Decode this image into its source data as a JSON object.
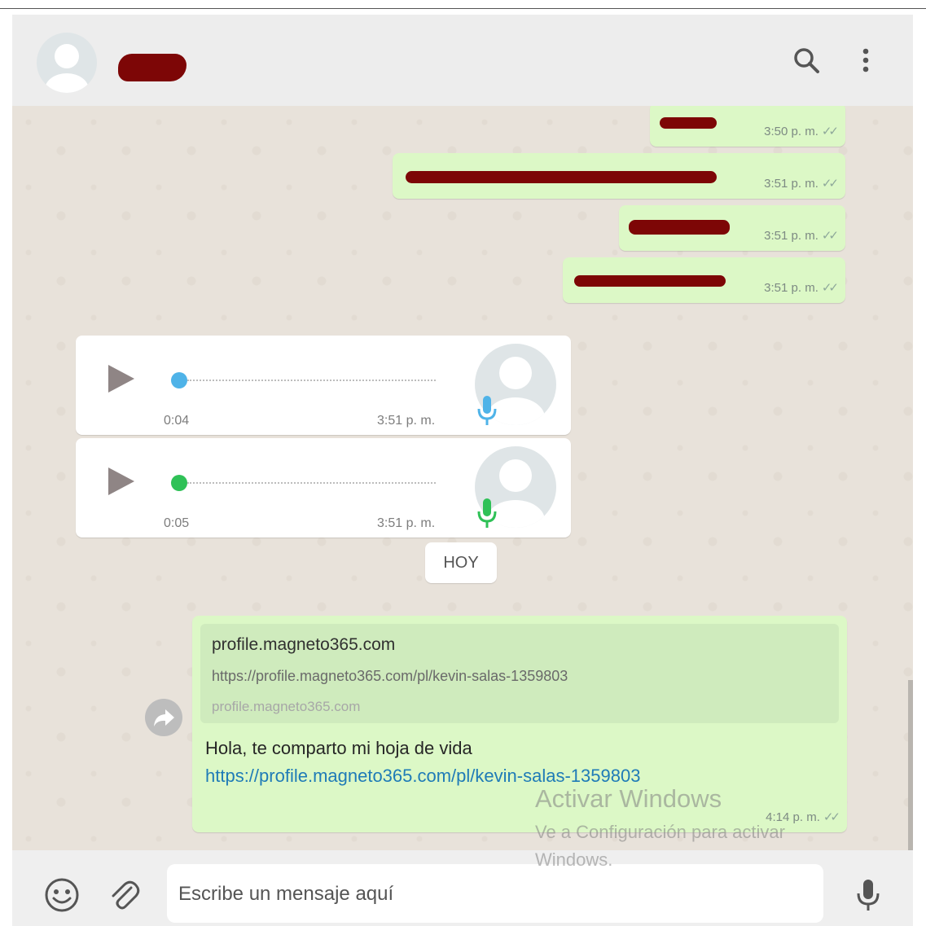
{
  "header": {
    "contact_name": ""
  },
  "messages_out": [
    {
      "time": "3:50 p. m."
    },
    {
      "time": "3:51 p. m."
    },
    {
      "time": "3:51 p. m."
    },
    {
      "time": "3:51 p. m."
    }
  ],
  "voice_notes": [
    {
      "duration": "0:04",
      "time": "3:51 p. m.",
      "accent": "#4fb3e8"
    },
    {
      "duration": "0:05",
      "time": "3:51 p. m.",
      "accent": "#2fc157"
    }
  ],
  "date_divider": "HOY",
  "link_message": {
    "preview_title": "profile.magneto365.com",
    "preview_url": "https://profile.magneto365.com/pl/kevin-salas-1359803",
    "preview_domain": "profile.magneto365.com",
    "text": "Hola, te comparto mi hoja de vida",
    "link": "https://profile.magneto365.com/pl/kevin-salas-1359803",
    "time": "4:14 p. m."
  },
  "composer": {
    "placeholder": "Escribe un mensaje aquí"
  },
  "watermark": {
    "title": "Activar Windows",
    "subtitle": "Ve a Configuración para activar Windows."
  },
  "colors": {
    "outgoing": "#dcf8c6",
    "incoming": "#ffffff",
    "redaction": "#7d0606",
    "link": "#1f7bb7"
  }
}
